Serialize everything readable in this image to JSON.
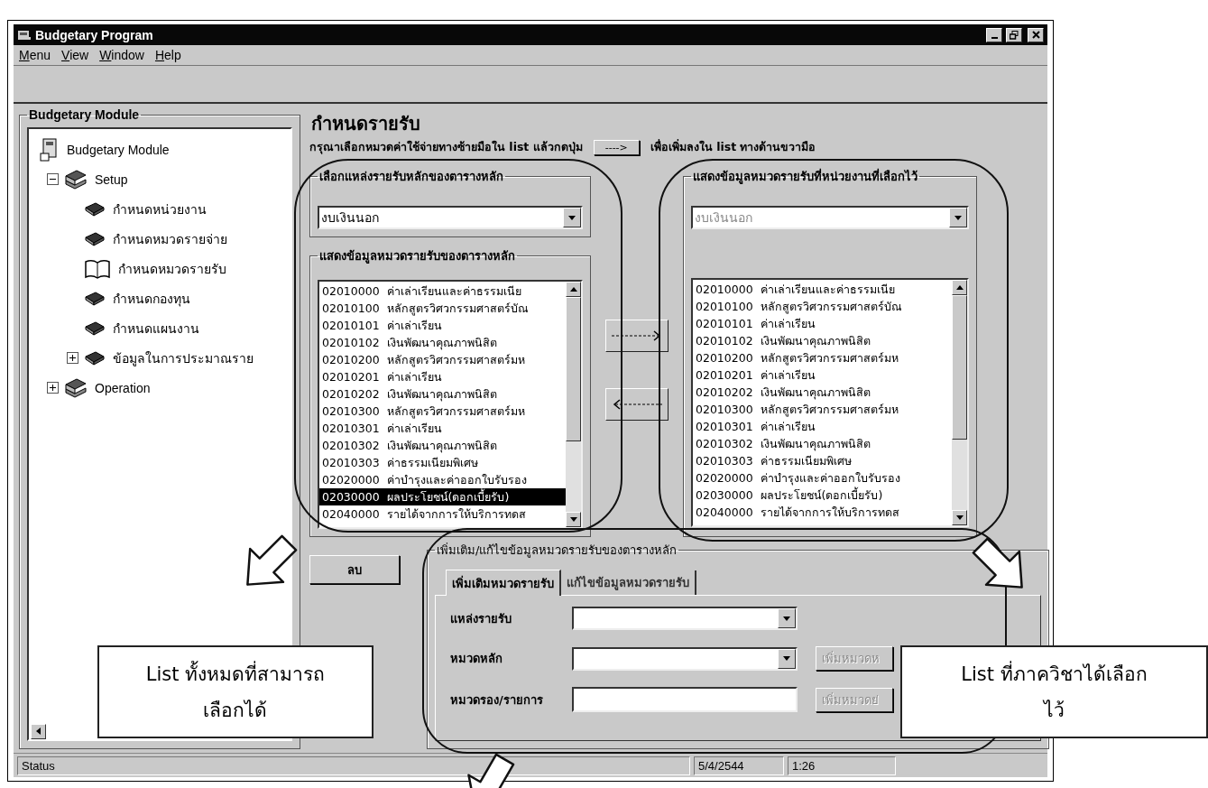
{
  "window": {
    "title": "Budgetary Program"
  },
  "menu": [
    "Menu",
    "View",
    "Window",
    "Help"
  ],
  "sidebar": {
    "title": "Budgetary Module",
    "tree": [
      {
        "label": "Budgetary Module",
        "selected": false,
        "children": [
          {
            "label": "Setup",
            "selected": false,
            "expanded": true,
            "children": [
              {
                "label": "กำหนดหน่วยงาน",
                "selected": false
              },
              {
                "label": "กำหนดหมวดรายจ่าย",
                "selected": false
              },
              {
                "label": "กำหนดหมวดรายรับ",
                "selected": true
              },
              {
                "label": "กำหนดกองทุน",
                "selected": false
              },
              {
                "label": "กำหนดแผนงาน",
                "selected": false
              },
              {
                "label": "ข้อมูลในการประมาณราย",
                "selected": false,
                "expanded": false
              }
            ]
          },
          {
            "label": "Operation",
            "selected": false,
            "expanded": false
          }
        ]
      }
    ]
  },
  "page": {
    "title": "กำหนดรายรับ",
    "instruction_before": "กรุณาเลือกหมวดค่าใช้จ่ายทางซ้ายมือใน list แล้วกดปุ่ม",
    "add_button": "---->",
    "instruction_after": "เพื่อเพิ่มลงใน list ทางด้านขวามือ"
  },
  "source_panel": {
    "source_group": "เลือกแหล่งรายรับหลักของตารางหลัก",
    "source_value": "งบเงินนอก",
    "list_group": "แสดงข้อมูลหมวดรายรับของตารางหลัก",
    "items": [
      {
        "code": "02010000",
        "name": "ค่าเล่าเรียนและค่าธรรมเนีย",
        "selected": false
      },
      {
        "code": "02010100",
        "name": "หลักสูตรวิศวกรรมศาสตร์บัณ",
        "selected": false
      },
      {
        "code": "02010101",
        "name": "ค่าเล่าเรียน",
        "selected": false
      },
      {
        "code": "02010102",
        "name": "เงินพัฒนาคุณภาพนิสิต",
        "selected": false
      },
      {
        "code": "02010200",
        "name": "หลักสูตรวิศวกรรมศาสตร์มห",
        "selected": false
      },
      {
        "code": "02010201",
        "name": "ค่าเล่าเรียน",
        "selected": false
      },
      {
        "code": "02010202",
        "name": "เงินพัฒนาคุณภาพนิสิต",
        "selected": false
      },
      {
        "code": "02010300",
        "name": "หลักสูตรวิศวกรรมศาสตร์มห",
        "selected": false
      },
      {
        "code": "02010301",
        "name": "ค่าเล่าเรียน",
        "selected": false
      },
      {
        "code": "02010302",
        "name": "เงินพัฒนาคุณภาพนิสิต",
        "selected": false
      },
      {
        "code": "02010303",
        "name": "ค่าธรรมเนียมพิเศษ",
        "selected": false
      },
      {
        "code": "02020000",
        "name": "ค่าบำรุงและค่าออกใบรับรอง",
        "selected": false
      },
      {
        "code": "02030000",
        "name": "ผลประโยชน์(ดอกเบี้ยรับ)",
        "selected": true
      },
      {
        "code": "02040000",
        "name": "รายได้จากการให้บริการทดส",
        "selected": false
      }
    ]
  },
  "selected_panel": {
    "group": "แสดงข้อมูลหมวดรายรับที่หน่วยงานที่เลือกไว้",
    "source_value": "งบเงินนอก",
    "source_disabled": true,
    "items": [
      {
        "code": "02010000",
        "name": "ค่าเล่าเรียนและค่าธรรมเนีย",
        "selected": false
      },
      {
        "code": "02010100",
        "name": "หลักสูตรวิศวกรรมศาสตร์บัณ",
        "selected": false
      },
      {
        "code": "02010101",
        "name": "ค่าเล่าเรียน",
        "selected": false
      },
      {
        "code": "02010102",
        "name": "เงินพัฒนาคุณภาพนิสิต",
        "selected": false
      },
      {
        "code": "02010200",
        "name": "หลักสูตรวิศวกรรมศาสตร์มห",
        "selected": false
      },
      {
        "code": "02010201",
        "name": "ค่าเล่าเรียน",
        "selected": false
      },
      {
        "code": "02010202",
        "name": "เงินพัฒนาคุณภาพนิสิต",
        "selected": false
      },
      {
        "code": "02010300",
        "name": "หลักสูตรวิศวกรรมศาสตร์มห",
        "selected": false
      },
      {
        "code": "02010301",
        "name": "ค่าเล่าเรียน",
        "selected": false
      },
      {
        "code": "02010302",
        "name": "เงินพัฒนาคุณภาพนิสิต",
        "selected": false
      },
      {
        "code": "02010303",
        "name": "ค่าธรรมเนียมพิเศษ",
        "selected": false
      },
      {
        "code": "02020000",
        "name": "ค่าบำรุงและค่าออกใบรับรอง",
        "selected": false
      },
      {
        "code": "02030000",
        "name": "ผลประโยชน์(ดอกเบี้ยรับ)",
        "selected": false
      },
      {
        "code": "02040000",
        "name": "รายได้จากการให้บริการทดส",
        "selected": false
      }
    ]
  },
  "delete_button": "ลบ",
  "edit_panel": {
    "group": "เพิ่มเติม/แก้ไขข้อมูลหมวดรายรับของตารางหลัก",
    "tabs": [
      {
        "label": "เพิ่มเติมหมวดรายรับ",
        "selected": true
      },
      {
        "label": "แก้ไขข้อมูลหมวดรายรับ",
        "selected": false
      }
    ],
    "fields": [
      {
        "label": "แหล่งรายรับ",
        "kind": "combo"
      },
      {
        "label": "หมวดหลัก",
        "kind": "combo",
        "button": {
          "label": "เพิ่มหมวดห",
          "disabled": true
        }
      },
      {
        "label": "หมวดรอง/รายการ",
        "kind": "text",
        "button": {
          "label": "เพิ่มหมวดย่",
          "disabled": true
        }
      }
    ]
  },
  "status_bar": [
    "Status",
    "5/4/2544",
    "1:26"
  ],
  "callouts": [
    {
      "lines": [
        "List ทั้งหมดที่สามารถ",
        "เลือกได้"
      ]
    },
    {
      "lines": [
        "List ที่ภาควิชาได้เลือก",
        "ไว้"
      ]
    }
  ]
}
